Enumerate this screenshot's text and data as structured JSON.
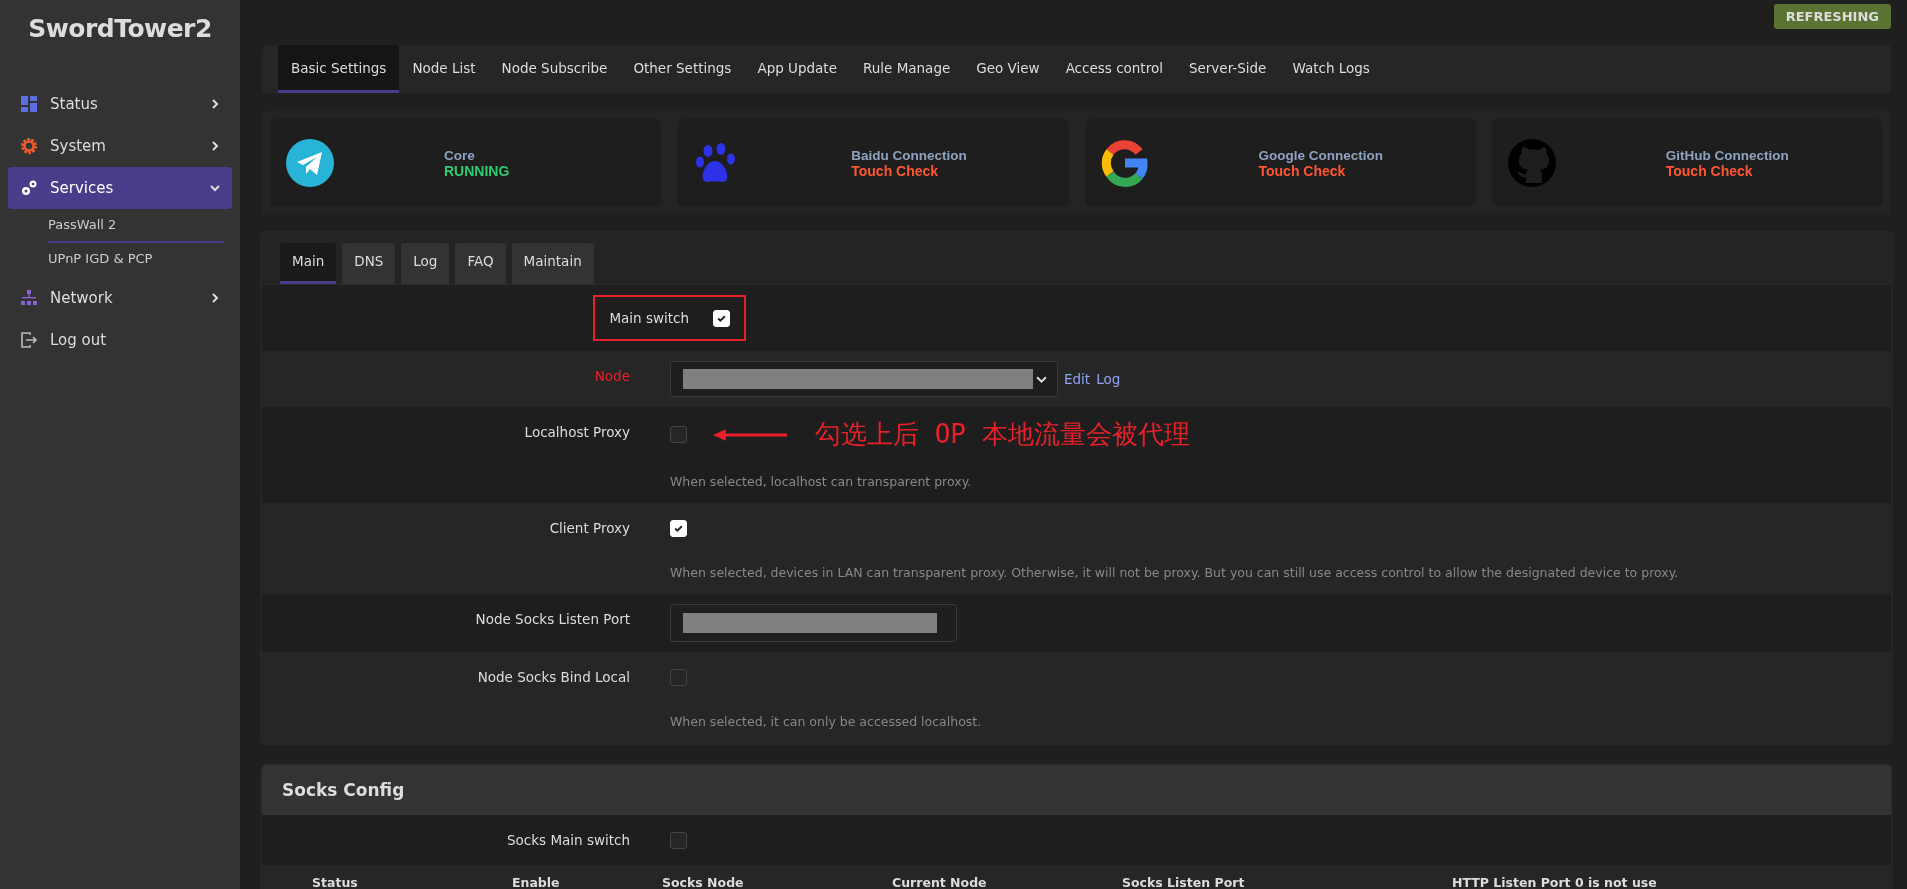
{
  "sidebar": {
    "logo": "SwordTower2",
    "items": [
      {
        "kind": "status",
        "label": "Status",
        "expanded": false,
        "selected": false
      },
      {
        "kind": "system",
        "label": "System",
        "expanded": false,
        "selected": false
      },
      {
        "kind": "services",
        "label": "Services",
        "expanded": true,
        "selected": true,
        "children": [
          {
            "label": "PassWall 2",
            "selected": true
          },
          {
            "label": "UPnP IGD & PCP",
            "selected": false
          }
        ]
      },
      {
        "kind": "network",
        "label": "Network",
        "expanded": false,
        "selected": false
      },
      {
        "kind": "logout",
        "label": "Log out",
        "selected": false
      }
    ]
  },
  "refresh_badge": "REFRESHING",
  "top_tabs": [
    {
      "label": "Basic Settings",
      "selected": true
    },
    {
      "label": "Node List",
      "selected": false
    },
    {
      "label": "Node Subscribe",
      "selected": false
    },
    {
      "label": "Other Settings",
      "selected": false
    },
    {
      "label": "App Update",
      "selected": false
    },
    {
      "label": "Rule Manage",
      "selected": false
    },
    {
      "label": "Geo View",
      "selected": false
    },
    {
      "label": "Access control",
      "selected": false
    },
    {
      "label": "Server-Side",
      "selected": false
    },
    {
      "label": "Watch Logs",
      "selected": false
    }
  ],
  "status_cards": [
    {
      "kind": "telegram",
      "title": "Core",
      "status": "RUNNING",
      "color": "#2ecc71"
    },
    {
      "kind": "paw",
      "title": "Baidu Connection",
      "status": "Touch Check",
      "color": "#ff5733"
    },
    {
      "kind": "google",
      "title": "Google Connection",
      "status": "Touch Check",
      "color": "#ff5733"
    },
    {
      "kind": "github",
      "title": "GitHub Connection",
      "status": "Touch Check",
      "color": "#ff5733"
    }
  ],
  "sub_tabs": [
    {
      "label": "Main",
      "selected": true
    },
    {
      "label": "DNS",
      "selected": false
    },
    {
      "label": "Log",
      "selected": false
    },
    {
      "label": "FAQ",
      "selected": false
    },
    {
      "label": "Maintain",
      "selected": false
    }
  ],
  "form": {
    "rows": [
      {
        "kind": "checkbox",
        "label": "Main switch",
        "checked": true,
        "highlighted": true
      },
      {
        "kind": "select",
        "label": "Node",
        "required": true,
        "links": [
          "Edit",
          "Log"
        ]
      },
      {
        "kind": "checkbox",
        "label": "Localhost Proxy",
        "checked": false,
        "hint": "When selected, localhost can transparent proxy.",
        "annotation": "勾选上后 OP 本地流量会被代理"
      },
      {
        "kind": "checkbox",
        "label": "Client Proxy",
        "checked": true,
        "hint": "When selected, devices in LAN can transparent proxy. Otherwise, it will not be proxy. But you can still use access control to allow the designated device to proxy."
      },
      {
        "kind": "text",
        "label": "Node Socks Listen Port"
      },
      {
        "kind": "checkbox",
        "label": "Node Socks Bind Local",
        "checked": false,
        "hint": "When selected, it can only be accessed localhost."
      }
    ]
  },
  "socks_config": {
    "title": "Socks Config",
    "rows": [
      {
        "kind": "checkbox",
        "label": "Socks Main switch",
        "checked": false
      }
    ],
    "table": {
      "columns": [
        "Status",
        "Enable",
        "Socks Node",
        "Current Node",
        "Socks Listen Port",
        "HTTP Listen Port 0 is not use"
      ]
    }
  }
}
